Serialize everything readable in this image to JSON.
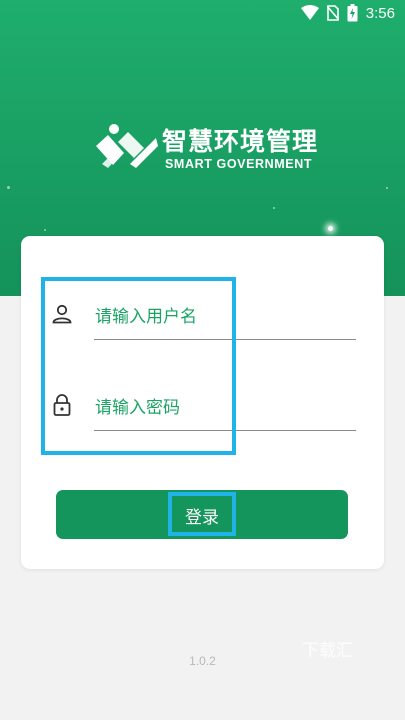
{
  "status_bar": {
    "time": "3:56",
    "icons": [
      "wifi-icon",
      "no-sim-icon",
      "battery-charging-icon"
    ]
  },
  "app": {
    "title": "智慧环境管理",
    "subtitle": "SMART GOVERNMENT"
  },
  "form": {
    "username_placeholder": "请输入用户名",
    "password_placeholder": "请输入密码",
    "login_label": "登录"
  },
  "footer": {
    "version": "1.0.2",
    "watermark": "下载汇"
  },
  "colors": {
    "brand_green": "#1aa464",
    "button_green": "#13955b",
    "highlight": "#1fb3e8"
  }
}
